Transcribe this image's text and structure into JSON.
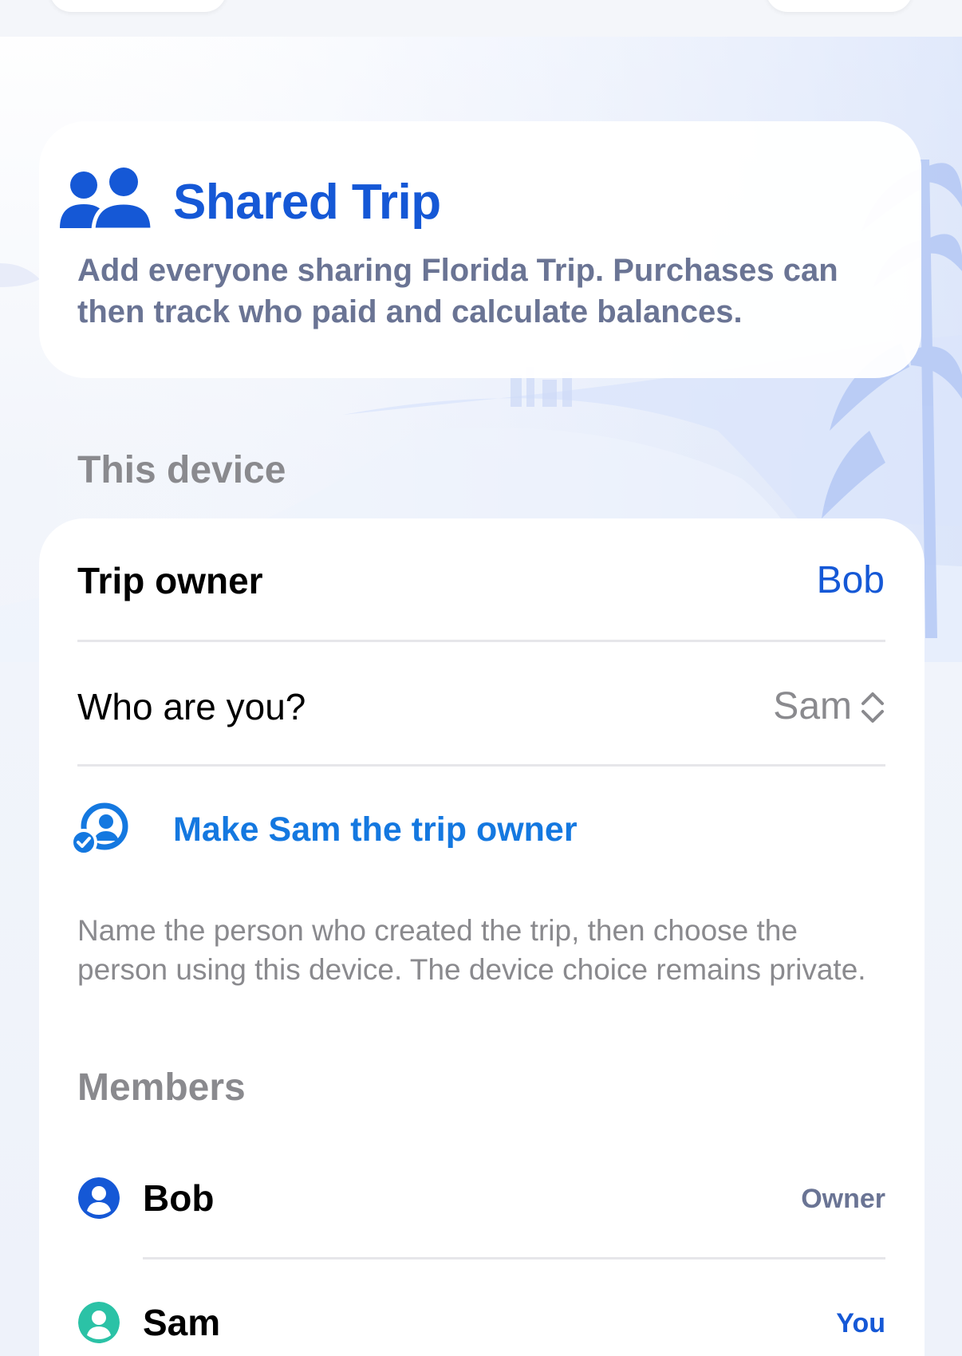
{
  "header": {
    "title": "Shared Trip",
    "description": "Add everyone sharing Florida Trip. Purchases can then track who paid and calculate balances."
  },
  "this_device": {
    "section_label": "This device",
    "trip_owner_label": "Trip owner",
    "trip_owner_value": "Bob",
    "who_label": "Who are you?",
    "who_value": "Sam",
    "make_owner_label": "Make Sam the trip owner",
    "footnote": "Name the person who created the trip, then choose the person using this device. The device choice remains private."
  },
  "members": {
    "section_label": "Members",
    "items": [
      {
        "name": "Bob",
        "role": "Owner",
        "avatar_color": "#1558d6",
        "role_color": "#6a7494"
      },
      {
        "name": "Sam",
        "role": "You",
        "avatar_color": "#2bc2a6",
        "role_color": "#1558d6"
      }
    ]
  },
  "colors": {
    "accent": "#1558d6",
    "link": "#1478e0",
    "secondary_text": "#8a8a8e"
  }
}
